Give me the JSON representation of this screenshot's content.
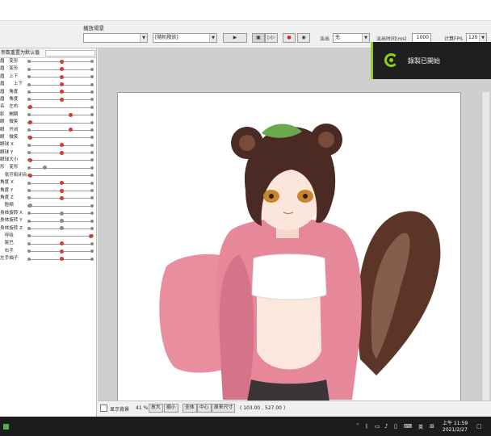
{
  "toolbar": {
    "scene_label": "播放場景",
    "scene_select": "",
    "motion_select": "[隨机撥放]",
    "play_label": "▶",
    "frame_label": "▣",
    "step_label": "▷▷",
    "record_label": "●",
    "stop_label": "◉",
    "loop_label": "淡出",
    "loop_select": "无",
    "duration_label": "淡出时间(ms)",
    "duration_value": "1000",
    "fps_label": "计算FPS",
    "fps_value": "120"
  },
  "notification": {
    "message": "錄製已開始",
    "accent_color": "#8fcf1f"
  },
  "param_panel": {
    "header": "参数重置为默认值",
    "rows": [
      {
        "label": "眉　变形",
        "pos": 0.52,
        "color": "red"
      },
      {
        "label": "眉　变形",
        "pos": 0.52,
        "color": "red"
      },
      {
        "label": "眉　上下",
        "pos": 0.52,
        "color": "red"
      },
      {
        "label": "眉　　上下",
        "pos": 0.52,
        "color": "red"
      },
      {
        "label": "眉　角度",
        "pos": 0.52,
        "color": "red"
      },
      {
        "label": "眉　角度",
        "pos": 0.52,
        "color": "red"
      },
      {
        "label": "名　左右",
        "pos": 0.02,
        "color": "red"
      },
      {
        "label": "影　開閉",
        "pos": 0.66,
        "color": "red"
      },
      {
        "label": "眼　微笑",
        "pos": 0.02,
        "color": "red"
      },
      {
        "label": "眼　开闭",
        "pos": 0.66,
        "color": "red"
      },
      {
        "label": "眼　微笑",
        "pos": 0.02,
        "color": "red"
      },
      {
        "label": "眼球 X",
        "pos": 0.52,
        "color": "red"
      },
      {
        "label": "眼球 Y",
        "pos": 0.52,
        "color": "red"
      },
      {
        "label": "眼球大小",
        "pos": 0.02,
        "color": "red"
      },
      {
        "label": "形　变形",
        "pos": 0.25,
        "color": "grey"
      },
      {
        "label": "　张开和闭合",
        "pos": 0.02,
        "color": "red"
      },
      {
        "label": "角度 X",
        "pos": 0.52,
        "color": "red"
      },
      {
        "label": "角度 Y",
        "pos": 0.52,
        "color": "red"
      },
      {
        "label": "角度 Z",
        "pos": 0.52,
        "color": "red"
      },
      {
        "label": "　脸颊",
        "pos": 0.02,
        "color": "grey"
      },
      {
        "label": "身体旋转 X",
        "pos": 0.52,
        "color": "grey"
      },
      {
        "label": "身体旋转 Y",
        "pos": 0.52,
        "color": "grey"
      },
      {
        "label": "身体旋转 Z",
        "pos": 0.52,
        "color": "grey"
      },
      {
        "label": "　呼吸",
        "pos": 0.98,
        "color": "red"
      },
      {
        "label": "　尾巴",
        "pos": 0.52,
        "color": "red"
      },
      {
        "label": "　右手",
        "pos": 0.52,
        "color": "red"
      },
      {
        "label": "左手袖子",
        "pos": 0.52,
        "color": "red"
      }
    ]
  },
  "statusbar": {
    "show_bg_label": "显示背景",
    "zoom": "41 %",
    "zoom_in": "放大",
    "zoom_out": "缩小",
    "fit_all": "全体",
    "center": "中心",
    "original": "原来尺寸",
    "coords": "( 103.00 , 527.00 )"
  },
  "taskbar": {
    "time": "上午 11:59",
    "date": "2021/2/27",
    "lang": "英"
  }
}
